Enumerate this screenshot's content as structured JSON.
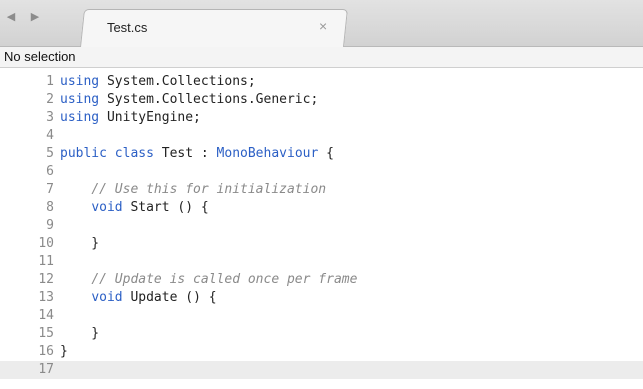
{
  "window": {
    "back_icon": "chevron-left-icon",
    "forward_icon": "chevron-right-icon"
  },
  "tab": {
    "title": "Test.cs",
    "close_symbol": "×"
  },
  "selection_bar": {
    "label": "No selection"
  },
  "colors": {
    "keyword": "#2b5fc5",
    "comment": "#8a8a8a",
    "current_line": "#ececec"
  },
  "editor": {
    "current_line": 17,
    "lines": [
      {
        "n": "1",
        "segments": [
          {
            "t": "using ",
            "c": "kw"
          },
          {
            "t": "System.Collections;",
            "c": ""
          }
        ]
      },
      {
        "n": "2",
        "segments": [
          {
            "t": "using ",
            "c": "kw"
          },
          {
            "t": "System.Collections.Generic;",
            "c": ""
          }
        ]
      },
      {
        "n": "3",
        "segments": [
          {
            "t": "using ",
            "c": "kw"
          },
          {
            "t": "UnityEngine;",
            "c": ""
          }
        ]
      },
      {
        "n": "4",
        "segments": []
      },
      {
        "n": "5",
        "segments": [
          {
            "t": "public class ",
            "c": "kw"
          },
          {
            "t": "Test : ",
            "c": ""
          },
          {
            "t": "MonoBehaviour",
            "c": "kw"
          },
          {
            "t": " {",
            "c": ""
          }
        ]
      },
      {
        "n": "6",
        "segments": []
      },
      {
        "n": "7",
        "segments": [
          {
            "t": "    ",
            "c": ""
          },
          {
            "t": "// Use this for initialization",
            "c": "cm"
          }
        ]
      },
      {
        "n": "8",
        "segments": [
          {
            "t": "    ",
            "c": ""
          },
          {
            "t": "void",
            "c": "kw"
          },
          {
            "t": " Start () {",
            "c": ""
          }
        ]
      },
      {
        "n": "9",
        "segments": []
      },
      {
        "n": "10",
        "segments": [
          {
            "t": "    }",
            "c": ""
          }
        ]
      },
      {
        "n": "11",
        "segments": []
      },
      {
        "n": "12",
        "segments": [
          {
            "t": "    ",
            "c": ""
          },
          {
            "t": "// Update is called once per frame",
            "c": "cm"
          }
        ]
      },
      {
        "n": "13",
        "segments": [
          {
            "t": "    ",
            "c": ""
          },
          {
            "t": "void",
            "c": "kw"
          },
          {
            "t": " Update () {",
            "c": ""
          }
        ]
      },
      {
        "n": "14",
        "segments": []
      },
      {
        "n": "15",
        "segments": [
          {
            "t": "    }",
            "c": ""
          }
        ]
      },
      {
        "n": "16",
        "segments": [
          {
            "t": "}",
            "c": ""
          }
        ]
      },
      {
        "n": "17",
        "segments": []
      }
    ]
  }
}
